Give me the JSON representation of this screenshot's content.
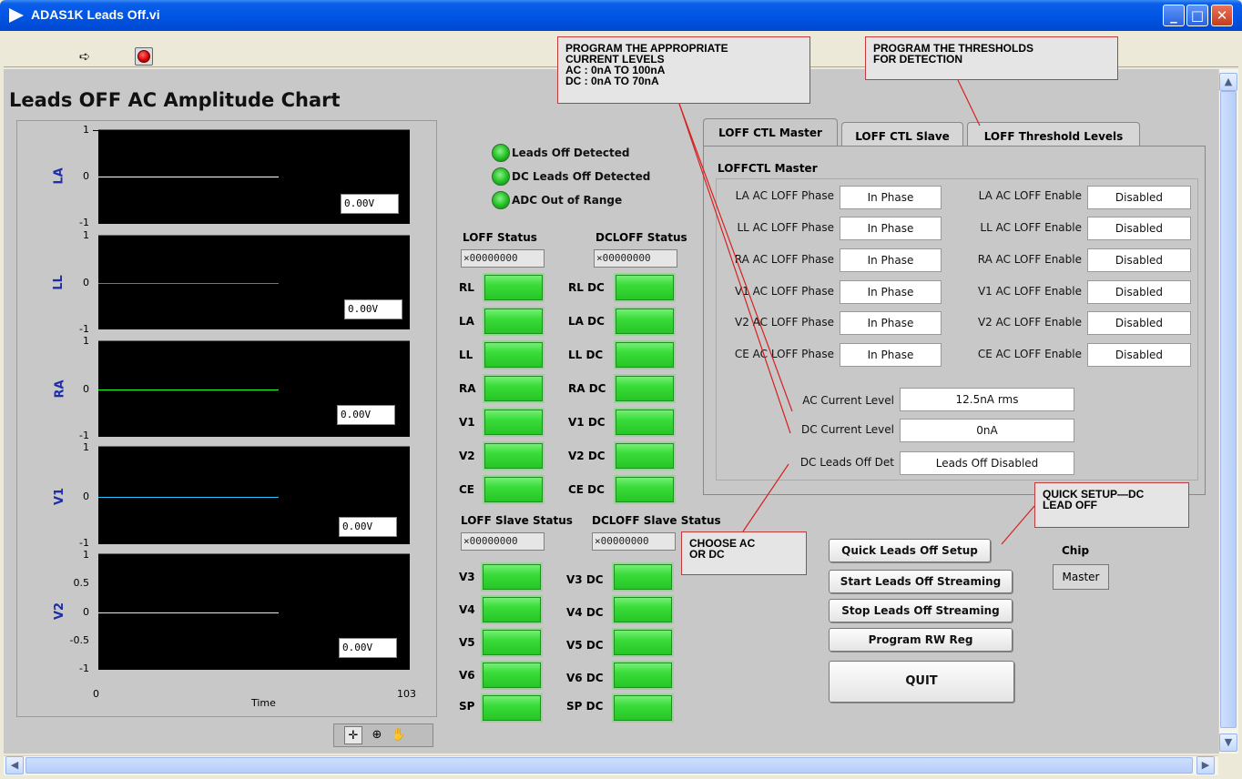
{
  "window": {
    "title": "ADAS1K Leads Off.vi"
  },
  "chart": {
    "title": "Leads OFF AC Amplitude Chart",
    "x_axis": {
      "start": "0",
      "end": "103",
      "title": "Time"
    },
    "plots": [
      {
        "label": "LA",
        "ticks": [
          "1",
          "0",
          "-1"
        ],
        "readout": "0.00V",
        "color": "#ffffff"
      },
      {
        "label": "LL",
        "ticks": [
          "1",
          "0",
          "-1"
        ],
        "readout": "0.00V",
        "color": "#ff3b3b"
      },
      {
        "label": "RA",
        "ticks": [
          "1",
          "0",
          "-1"
        ],
        "readout": "0.00V",
        "color": "#22ff22"
      },
      {
        "label": "V1",
        "ticks": [
          "1",
          "0",
          "-1"
        ],
        "readout": "0.00V",
        "color": "#22c8ff"
      },
      {
        "label": "V2",
        "ticks": [
          "1",
          "0.5",
          "0",
          "-0.5",
          "-1"
        ],
        "readout": "0.00V",
        "color": "#ffff44"
      }
    ]
  },
  "indicators": [
    {
      "label": "Leads Off Detected"
    },
    {
      "label": "DC Leads Off Detected"
    },
    {
      "label": "ADC Out of Range"
    }
  ],
  "status": {
    "loff_title": "LOFF Status",
    "dcloff_title": "DCLOFF Status",
    "loff_value": "×00000000",
    "dcloff_value": "×00000000",
    "master_leads": [
      "RL",
      "LA",
      "LL",
      "RA",
      "V1",
      "V2",
      "CE"
    ],
    "master_dc_leads": [
      "RL DC",
      "LA DC",
      "LL DC",
      "RA DC",
      "V1 DC",
      "V2 DC",
      "CE DC"
    ],
    "loff_slave_title": "LOFF Slave Status",
    "dcloff_slave_title": "DCLOFF Slave Status",
    "loff_slave_value": "×00000000",
    "dcloff_slave_value": "×00000000",
    "slave_leads": [
      "V3",
      "V4",
      "V5",
      "V6",
      "SP"
    ],
    "slave_dc_leads": [
      "V3 DC",
      "V4 DC",
      "V5 DC",
      "V6 DC",
      "SP DC"
    ]
  },
  "tabs": {
    "items": [
      "LOFF CTL Master",
      "LOFF CTL Slave",
      "LOFF Threshold Levels"
    ],
    "active": "LOFF CTL Master",
    "group_title": "LOFFCTL Master",
    "rows": [
      {
        "phase_label": "LA AC LOFF Phase",
        "phase_value": "In Phase",
        "enable_label": "LA AC LOFF Enable",
        "enable_value": "Disabled"
      },
      {
        "phase_label": "LL AC LOFF Phase",
        "phase_value": "In Phase",
        "enable_label": "LL AC LOFF Enable",
        "enable_value": "Disabled"
      },
      {
        "phase_label": "RA AC LOFF Phase",
        "phase_value": "In Phase",
        "enable_label": "RA AC LOFF Enable",
        "enable_value": "Disabled"
      },
      {
        "phase_label": "V1 AC LOFF Phase",
        "phase_value": "In Phase",
        "enable_label": "V1 AC LOFF Enable",
        "enable_value": "Disabled"
      },
      {
        "phase_label": "V2 AC LOFF Phase",
        "phase_value": "In Phase",
        "enable_label": "V2 AC LOFF Enable",
        "enable_value": "Disabled"
      },
      {
        "phase_label": "CE AC LOFF Phase",
        "phase_value": "In Phase",
        "enable_label": "CE AC LOFF Enable",
        "enable_value": "Disabled"
      }
    ],
    "ac_current_label": "AC Current Level",
    "ac_current_value": "12.5nA rms",
    "dc_current_label": "DC Current Level",
    "dc_current_value": "0nA",
    "dc_leads_off_label": "DC Leads Off Det",
    "dc_leads_off_value": "Leads Off Disabled"
  },
  "buttons": {
    "quick_setup": "Quick Leads Off Setup",
    "start_streaming": "Start Leads Off Streaming",
    "stop_streaming": "Stop Leads Off Streaming",
    "program_reg": "Program RW Reg",
    "quit": "QUIT"
  },
  "chip": {
    "label": "Chip",
    "value": "Master"
  },
  "callouts": {
    "current_levels": [
      "PROGRAM THE APPROPRIATE",
      "CURRENT LEVELS",
      "AC : 0nA TO 100nA",
      "DC : 0nA TO 70nA"
    ],
    "thresholds": [
      "PROGRAM THE THRESHOLDS",
      "FOR DETECTION"
    ],
    "quick_setup": [
      "QUICK SETUP—DC",
      "LEAD OFF"
    ],
    "choose": [
      "CHOOSE AC",
      "OR DC"
    ]
  }
}
